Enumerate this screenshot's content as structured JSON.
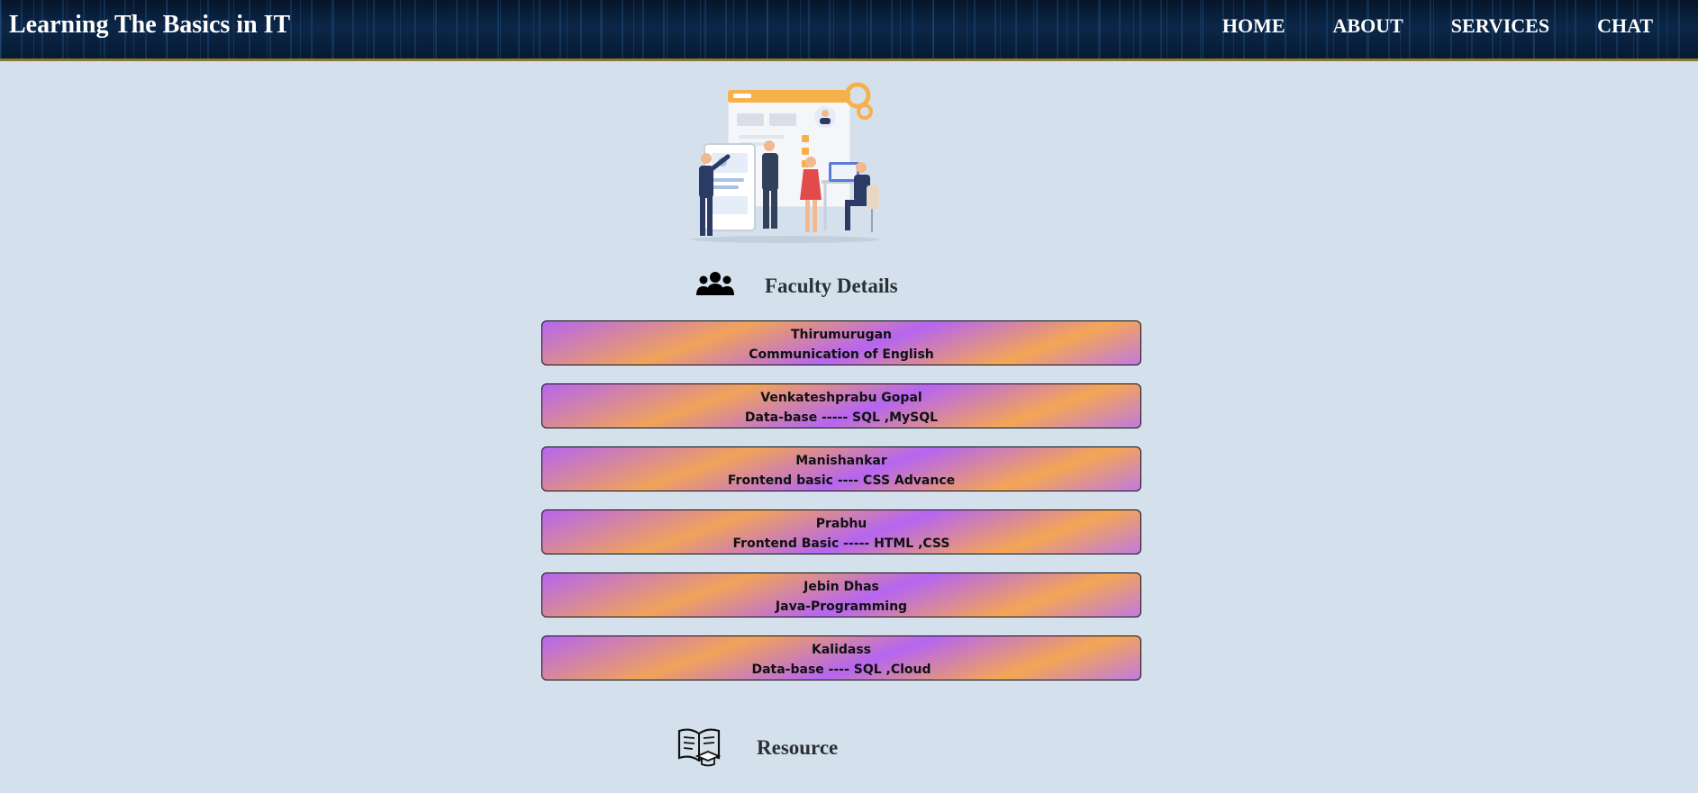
{
  "header": {
    "brand": "Learning The Basics in IT",
    "nav": [
      "HOME",
      "ABOUT",
      "SERVICES",
      "CHAT"
    ]
  },
  "hero": {
    "icon": "team-illustration"
  },
  "faculty": {
    "icon": "users-icon",
    "title": "Faculty Details",
    "items": [
      {
        "name": "Thirumurugan",
        "subject": "Communication of English"
      },
      {
        "name": "Venkateshprabu Gopal",
        "subject": "Data-base ----- SQL ,MySQL"
      },
      {
        "name": "Manishankar",
        "subject": "Frontend basic ---- CSS Advance"
      },
      {
        "name": "Prabhu",
        "subject": "Frontend Basic ----- HTML ,CSS"
      },
      {
        "name": "Jebin Dhas",
        "subject": "Java-Programming"
      },
      {
        "name": "Kalidass",
        "subject": "Data-base ---- SQL ,Cloud"
      }
    ]
  },
  "resource": {
    "icon": "open-book-icon",
    "title": "Resource"
  },
  "colors": {
    "background": "#d4e1ec",
    "card_purple": "#b565f0",
    "card_orange": "#f0a35a",
    "header_dark": "#0b2748"
  }
}
